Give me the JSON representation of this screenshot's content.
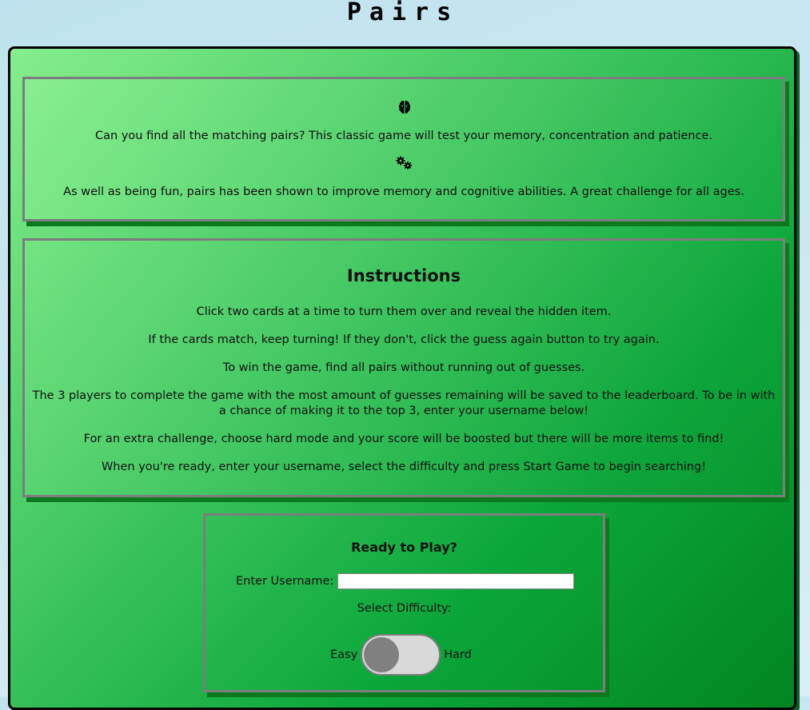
{
  "site": {
    "title": "Pairs"
  },
  "intro": {
    "brain_icon": "brain-icon",
    "text1": "Can you find all the matching pairs? This classic game will test your memory, concentration and patience.",
    "gears_icon": "gears-icon",
    "text2": "As well as being fun, pairs has been shown to improve memory and cognitive abilities. A great challenge for all ages."
  },
  "instructions": {
    "title": "Instructions",
    "lines": [
      "Click two cards at a time to turn them over and reveal the hidden item.",
      "If the cards match, keep turning! If they don't, click the guess again button to try again.",
      "To win the game, find all pairs without running out of guesses.",
      "The 3 players to complete the game with the most amount of guesses remaining will be saved to the leaderboard. To be in with a chance of making it to the top 3, enter your username below!",
      "For an extra challenge, choose hard mode and your score will be boosted but there will be more items to find!",
      "When you're ready, enter your username, select the difficulty and press Start Game to begin searching!"
    ]
  },
  "play": {
    "title": "Ready to Play?",
    "username_label": "Enter Username:",
    "username_value": "",
    "difficulty_label": "Select Difficulty:",
    "easy_label": "Easy",
    "hard_label": "Hard",
    "difficulty_selected": "Easy"
  },
  "colors": {
    "panel_light": "#86ee8e",
    "panel_dark": "#02861f",
    "box_border": "#7d7d7d",
    "shadow": "#0b7a1e"
  }
}
